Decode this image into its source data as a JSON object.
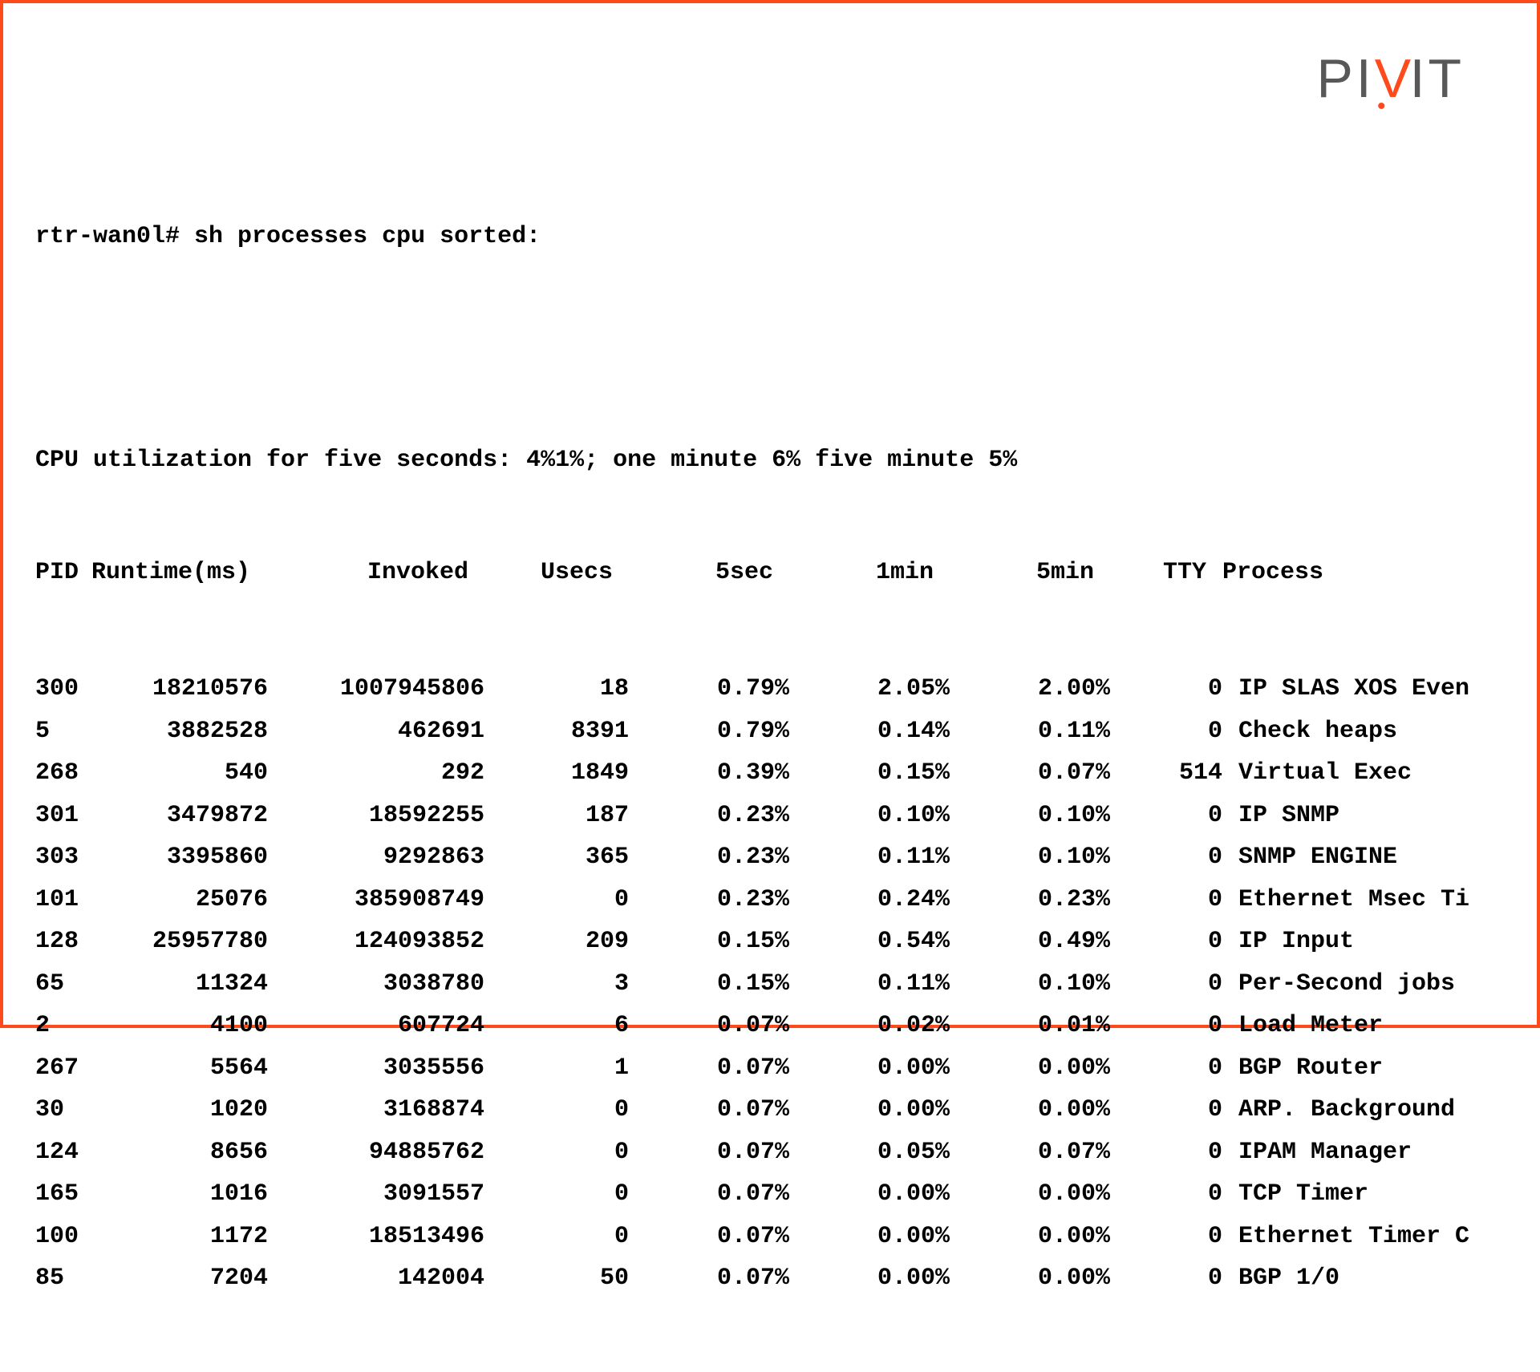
{
  "logo": {
    "p1": "PI",
    "v": "V",
    "p2": "IT"
  },
  "prompt": "rtr-wan0l# sh processes cpu sorted:",
  "cpu_line": "CPU utilization for five seconds: 4%1%; one minute 6% five minute 5%",
  "headers": {
    "pid": "PID",
    "runtime": "Runtime(ms)",
    "invoked": "Invoked",
    "usecs": "Usecs",
    "sec5": "5sec",
    "min1": "1min",
    "min5": "5min",
    "tty": "TTY",
    "process": "Process"
  },
  "rows": [
    {
      "pid": "300",
      "runtime": "18210576",
      "invoked": "1007945806",
      "usecs": "18",
      "sec5": "0.79%",
      "min1": "2.05%",
      "min5": "2.00%",
      "tty": "0",
      "process": "IP SLAS XOS Even"
    },
    {
      "pid": "5",
      "runtime": "3882528",
      "invoked": "462691",
      "usecs": "8391",
      "sec5": "0.79%",
      "min1": "0.14%",
      "min5": "0.11%",
      "tty": "0",
      "process": "Check heaps"
    },
    {
      "pid": "268",
      "runtime": "540",
      "invoked": "292",
      "usecs": "1849",
      "sec5": "0.39%",
      "min1": "0.15%",
      "min5": "0.07%",
      "tty": "514",
      "process": "Virtual Exec"
    },
    {
      "pid": "301",
      "runtime": "3479872",
      "invoked": "18592255",
      "usecs": "187",
      "sec5": "0.23%",
      "min1": "0.10%",
      "min5": "0.10%",
      "tty": "0",
      "process": "IP SNMP"
    },
    {
      "pid": "303",
      "runtime": "3395860",
      "invoked": "9292863",
      "usecs": "365",
      "sec5": "0.23%",
      "min1": "0.11%",
      "min5": "0.10%",
      "tty": "0",
      "process": "SNMP ENGINE"
    },
    {
      "pid": "101",
      "runtime": "25076",
      "invoked": "385908749",
      "usecs": "0",
      "sec5": "0.23%",
      "min1": "0.24%",
      "min5": "0.23%",
      "tty": "0",
      "process": "Ethernet Msec Ti"
    },
    {
      "pid": "128",
      "runtime": "25957780",
      "invoked": "124093852",
      "usecs": "209",
      "sec5": "0.15%",
      "min1": "0.54%",
      "min5": "0.49%",
      "tty": "0",
      "process": "IP Input"
    },
    {
      "pid": "65",
      "runtime": "11324",
      "invoked": "3038780",
      "usecs": "3",
      "sec5": "0.15%",
      "min1": "0.11%",
      "min5": "0.10%",
      "tty": "0",
      "process": "Per-Second jobs"
    },
    {
      "pid": "2",
      "runtime": "4100",
      "invoked": "607724",
      "usecs": "6",
      "sec5": "0.07%",
      "min1": "0.02%",
      "min5": "0.01%",
      "tty": "0",
      "process": "Load Meter"
    },
    {
      "pid": "267",
      "runtime": "5564",
      "invoked": "3035556",
      "usecs": "1",
      "sec5": "0.07%",
      "min1": "0.00%",
      "min5": "0.00%",
      "tty": "0",
      "process": "BGP Router"
    },
    {
      "pid": "30",
      "runtime": "1020",
      "invoked": "3168874",
      "usecs": "0",
      "sec5": "0.07%",
      "min1": "0.00%",
      "min5": "0.00%",
      "tty": "0",
      "process": "ARP. Background"
    },
    {
      "pid": "124",
      "runtime": "8656",
      "invoked": "94885762",
      "usecs": "0",
      "sec5": "0.07%",
      "min1": "0.05%",
      "min5": "0.07%",
      "tty": "0",
      "process": "IPAM Manager"
    },
    {
      "pid": "165",
      "runtime": "1016",
      "invoked": "3091557",
      "usecs": "0",
      "sec5": "0.07%",
      "min1": "0.00%",
      "min5": "0.00%",
      "tty": "0",
      "process": "TCP Timer"
    },
    {
      "pid": "100",
      "runtime": "1172",
      "invoked": "18513496",
      "usecs": "0",
      "sec5": "0.07%",
      "min1": "0.00%",
      "min5": "0.00%",
      "tty": "0",
      "process": "Ethernet Timer C"
    },
    {
      "pid": "85",
      "runtime": "7204",
      "invoked": "142004",
      "usecs": "50",
      "sec5": "0.07%",
      "min1": "0.00%",
      "min5": "0.00%",
      "tty": "0",
      "process": "BGP 1/0"
    }
  ]
}
